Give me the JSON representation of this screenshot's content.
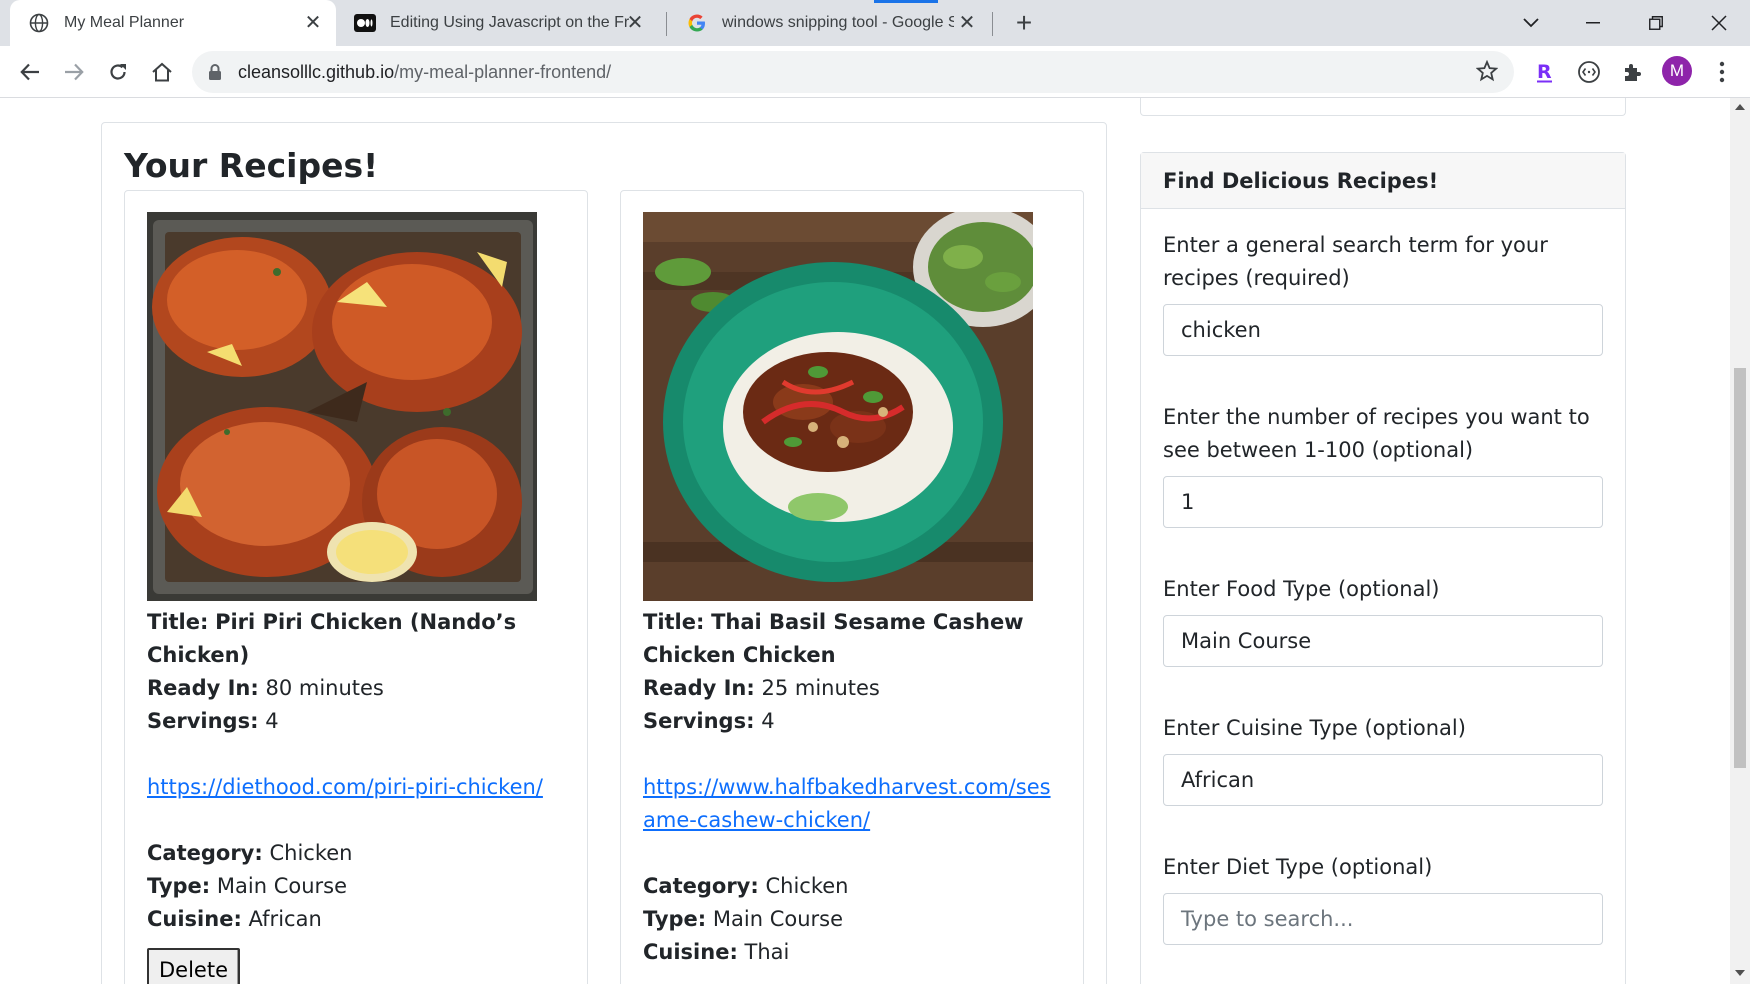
{
  "browser": {
    "tabs": [
      {
        "title": "My Meal Planner",
        "favicon": "globe-icon",
        "active": true
      },
      {
        "title": "Editing Using Javascript on the Fr",
        "favicon": "medium-icon",
        "active": false
      },
      {
        "title": "windows snipping tool - Google S",
        "favicon": "google-icon",
        "active": false
      }
    ],
    "url_host": "cleansolllc.github.io",
    "url_path": "/my-meal-planner-frontend/",
    "avatar_letter": "M"
  },
  "recipes": {
    "heading": "Your Recipes!",
    "labels": {
      "title": "Title:",
      "ready_in": "Ready In:",
      "servings": "Servings:",
      "category": "Category:",
      "type": "Type:",
      "cuisine": "Cuisine:"
    },
    "items": [
      {
        "title": "Piri Piri Chicken (Nando’s Chicken)",
        "ready_in": "80 minutes",
        "servings": "4",
        "url": "https://diethood.com/piri-piri-chicken/",
        "category": "Chicken",
        "type": "Main Course",
        "cuisine": "African",
        "delete_label": "Delete"
      },
      {
        "title": "Thai Basil Sesame Cashew Chicken Chicken",
        "ready_in": "25 minutes",
        "servings": "4",
        "url": "https://www.halfbakedharvest.com/sesame-cashew-chicken/",
        "category": "Chicken",
        "type": "Main Course",
        "cuisine": "Thai"
      }
    ]
  },
  "search": {
    "heading": "Find Delicious Recipes!",
    "fields": [
      {
        "label": "Enter a general search term for your recipes (required)",
        "value": "chicken",
        "placeholder": ""
      },
      {
        "label": "Enter the number of recipes you want to see between 1-100 (optional)",
        "value": "1",
        "placeholder": ""
      },
      {
        "label": "Enter Food Type (optional)",
        "value": "Main Course",
        "placeholder": ""
      },
      {
        "label": "Enter Cuisine Type (optional)",
        "value": "African",
        "placeholder": ""
      },
      {
        "label": "Enter Diet Type (optional)",
        "value": "",
        "placeholder": "Type to search..."
      }
    ]
  },
  "colors": {
    "link": "#0d6efd",
    "tabstrip": "#dee1e6",
    "avatar": "#8e24aa",
    "extension_r": "#7b2ff7"
  }
}
